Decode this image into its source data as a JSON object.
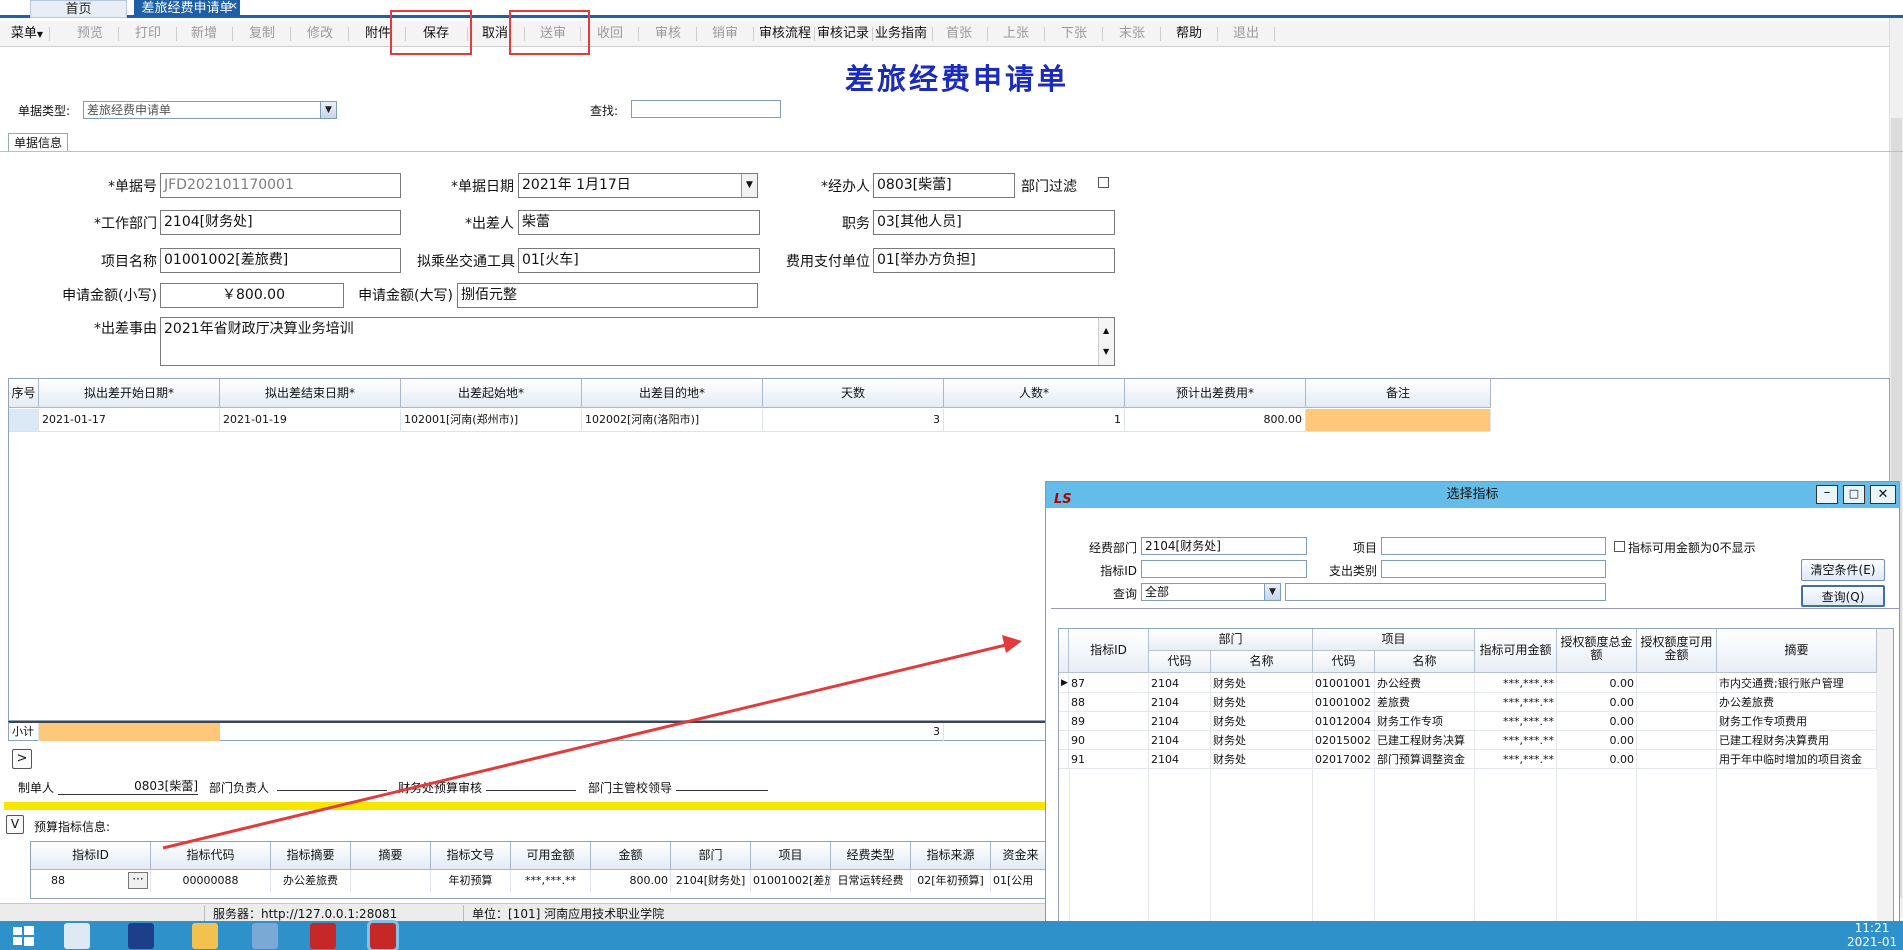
{
  "tabs": {
    "home": "首页",
    "form": "差旅经费申请单",
    "close": "×"
  },
  "toolbar": {
    "items": [
      {
        "label": "菜单",
        "enabled": true
      },
      {
        "label": "预览",
        "enabled": false
      },
      {
        "label": "打印",
        "enabled": false
      },
      {
        "label": "新增",
        "enabled": false
      },
      {
        "label": "复制",
        "enabled": false
      },
      {
        "label": "修改",
        "enabled": false
      },
      {
        "label": "附件",
        "enabled": true
      },
      {
        "label": "保存",
        "enabled": true
      },
      {
        "label": "取消",
        "enabled": true
      },
      {
        "label": "送审",
        "enabled": false
      },
      {
        "label": "收回",
        "enabled": false
      },
      {
        "label": "审核",
        "enabled": false
      },
      {
        "label": "销审",
        "enabled": false
      },
      {
        "label": "审核流程",
        "enabled": true
      },
      {
        "label": "审核记录",
        "enabled": true
      },
      {
        "label": "业务指南",
        "enabled": true
      },
      {
        "label": "首张",
        "enabled": false
      },
      {
        "label": "上张",
        "enabled": false
      },
      {
        "label": "下张",
        "enabled": false
      },
      {
        "label": "末张",
        "enabled": false
      },
      {
        "label": "帮助",
        "enabled": true
      },
      {
        "label": "退出",
        "enabled": false
      }
    ]
  },
  "title": "差旅经费申请单",
  "header": {
    "doc_type_label": "单据类型:",
    "doc_type_value": "差旅经费申请单",
    "search_label": "查找:",
    "search_value": ""
  },
  "subtab": "单据信息",
  "form": {
    "doc_no_label": "*单据号",
    "doc_no": "JFD202101170001",
    "date_label": "*单据日期",
    "date": "2021年  1月17日",
    "handler_label": "*经办人",
    "handler": "0803[柴蕾]",
    "dept_filter_label": "部门过滤",
    "work_dept_label": "*工作部门",
    "work_dept": "2104[财务处]",
    "traveler_label": "*出差人",
    "traveler": "柴蕾",
    "position_label": "职务",
    "position": "03[其他人员]",
    "project_label": "项目名称",
    "project": "01001002[差旅费]",
    "transport_label": "拟乘坐交通工具",
    "transport": "01[火车]",
    "payer_label": "费用支付单位",
    "payer": "01[举办方负担]",
    "amount_small_label": "申请金额(小写)",
    "amount_small": "￥800.00",
    "amount_big_label": "申请金额(大写)",
    "amount_big": "捌佰元整",
    "reason_label": "*出差事由",
    "reason": "2021年省财政厅决算业务培训"
  },
  "trip_grid": {
    "headers": [
      "序号",
      "拟出差开始日期*",
      "拟出差结束日期*",
      "出差起始地*",
      "出差目的地*",
      "天数",
      "人数*",
      "预计出差费用*",
      "备注"
    ],
    "rows": [
      {
        "start": "2021-01-17",
        "end": "2021-01-19",
        "from": "102001[河南(郑州市)]",
        "to": "102002[河南(洛阳市)]",
        "days": "3",
        "people": "1",
        "cost": "800.00",
        "note": ""
      }
    ],
    "subtotal_label": "小计",
    "subtotal_days": "3"
  },
  "signatures": {
    "maker_label": "制单人",
    "maker": "0803[柴蕾]",
    "dept_head_label": "部门负责人",
    "finance_label": "财务处预算审核",
    "leader_label": "部门主管校领导"
  },
  "budget": {
    "section_label": "预算指标信息:",
    "headers": [
      "指标ID",
      "指标代码",
      "指标摘要",
      "摘要",
      "指标文号",
      "可用金额",
      "金额",
      "部门",
      "项目",
      "经费类型",
      "指标来源",
      "资金来"
    ],
    "row": {
      "id": "88",
      "code": "00000088",
      "summary": "办公差旅费",
      "abstract": "",
      "doc_no": "年初预算",
      "available": "***,***.**",
      "amount": "800.00",
      "dept": "2104[财务处]",
      "project": "01001002[差旅费]",
      "fund_type": "日常运转经费",
      "source": "02[年初预算]",
      "fund_src": "01[公用"
    }
  },
  "status": {
    "server_label": "服务器：http://127.0.0.1:28081",
    "unit_label": "单位：[101] 河南应用技术职业学院"
  },
  "dialog": {
    "title": "选择指标",
    "fund_dept_label": "经费部门",
    "fund_dept": "2104[财务处]",
    "item_label": "项目",
    "item": "",
    "zero_hide_label": "指标可用金额为0不显示",
    "index_id_label": "指标ID",
    "index_id": "",
    "expense_type_label": "支出类别",
    "expense_type": "",
    "query_label": "查询",
    "query_value": "全部",
    "query_text": "",
    "clear_btn": "清空条件(E)",
    "query_btn": "查询(Q)",
    "headers": {
      "id": "指标ID",
      "dept": "部门",
      "project": "项目",
      "dept_code": "代码",
      "dept_name": "名称",
      "proj_code": "代码",
      "proj_name": "名称",
      "available": "指标可用金额",
      "auth_total": "授权额度总金额",
      "auth_avail": "授权额度可用金额",
      "summary": "摘要"
    },
    "rows": [
      {
        "id": "87",
        "dcode": "2104",
        "dname": "财务处",
        "pcode": "01001001",
        "pname": "办公经费",
        "avail": "***,***.**",
        "total": "0.00",
        "authav": "",
        "summary": "市内交通费;银行账户管理"
      },
      {
        "id": "88",
        "dcode": "2104",
        "dname": "财务处",
        "pcode": "01001002",
        "pname": "差旅费",
        "avail": "***,***.**",
        "total": "0.00",
        "authav": "",
        "summary": "办公差旅费"
      },
      {
        "id": "89",
        "dcode": "2104",
        "dname": "财务处",
        "pcode": "01012004",
        "pname": "财务工作专项",
        "avail": "***,***.**",
        "total": "0.00",
        "authav": "",
        "summary": "财务工作专项费用"
      },
      {
        "id": "90",
        "dcode": "2104",
        "dname": "财务处",
        "pcode": "02015002",
        "pname": "已建工程财务决算",
        "avail": "***,***.**",
        "total": "0.00",
        "authav": "",
        "summary": "已建工程财务决算费用"
      },
      {
        "id": "91",
        "dcode": "2104",
        "dname": "财务处",
        "pcode": "02017002",
        "pname": "部门预算调整资金",
        "avail": "***,***.**",
        "total": "0.00",
        "authav": "",
        "summary": "用于年中临时增加的项目资金"
      }
    ]
  },
  "taskbar": {
    "time": "11:21",
    "date": "2021-01"
  },
  "colors": {
    "accent": "#1f5fa8",
    "title_blue": "#1a2bbd",
    "highlight_orange": "#ffc77a",
    "dialog_title": "#63bde8",
    "annotation_red": "#e23b3b",
    "taskbar": "#2e91c9"
  }
}
